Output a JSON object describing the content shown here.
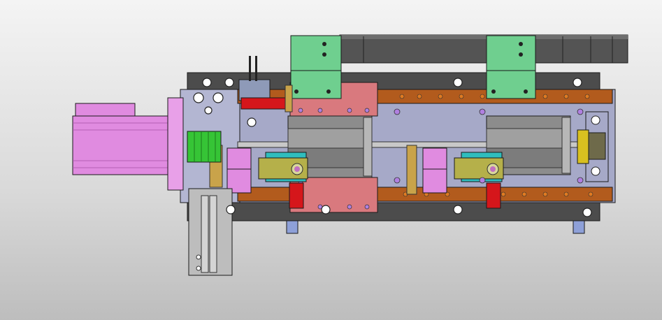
{
  "viewport": {
    "background": "gradient-gray"
  },
  "palette": {
    "frame": "#4c4c4c",
    "base_plate": "#a6a9c8",
    "carriage": "#d9797e",
    "rail": "#b25b1d",
    "motor": "#e08be0",
    "bracket": "#6fcf8f",
    "belt": "#545454",
    "cylinder": "#8c8c8c",
    "gripper": "#b5b04a",
    "coupling": "#36c436",
    "actuator_red": "#d5161b",
    "cyan_part": "#2fbdbd",
    "outline": "#1a1a1a"
  },
  "components": [
    "servo-motor",
    "coupling",
    "base-plate",
    "top-frame",
    "linear-rail-top",
    "linear-rail-bottom",
    "carriage-left",
    "mounting-bracket-left",
    "mounting-bracket-right",
    "timing-belt",
    "cylinder-left",
    "cylinder-right",
    "gripper-left",
    "gripper-right",
    "vertical-slide",
    "end-block",
    "sensor-bracket"
  ]
}
